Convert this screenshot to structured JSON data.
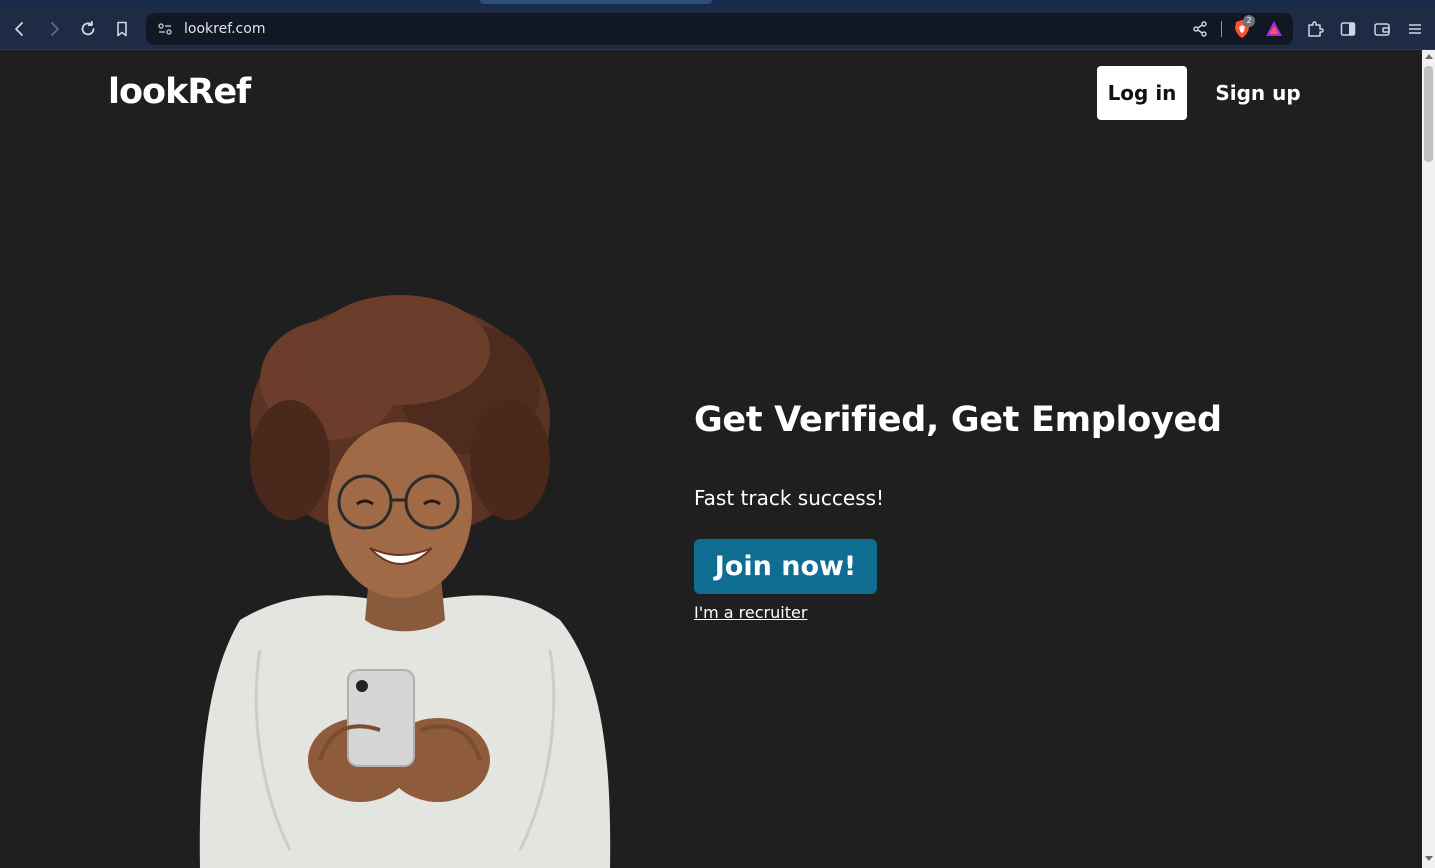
{
  "browser": {
    "url": "lookref.com",
    "shields_badge": "2"
  },
  "header": {
    "logo_text": "lookRef",
    "login_label": "Log in",
    "signup_label": "Sign up"
  },
  "hero": {
    "headline": "Get Verified, Get Employed",
    "subline": "Fast track success!",
    "cta_label": "Join now!",
    "recruiter_link": "I'm a recruiter"
  },
  "colors": {
    "page_bg": "#1f1f20",
    "cta_bg": "#0f6d92",
    "toolbar_bg": "#1e2b44"
  }
}
